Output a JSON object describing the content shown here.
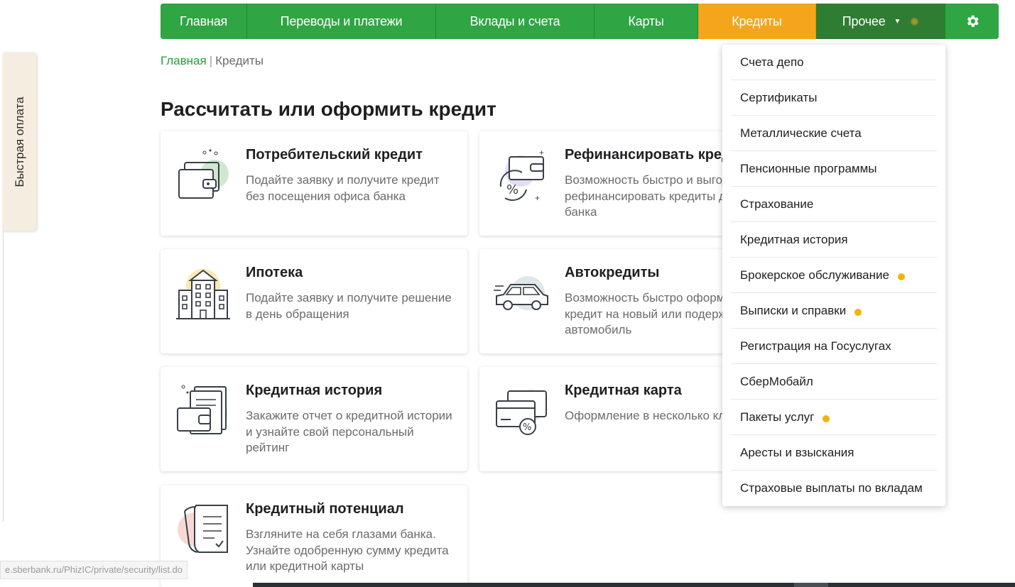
{
  "quick_pay": {
    "label": "Быстрая оплата"
  },
  "nav": {
    "items": [
      {
        "label": "Главная"
      },
      {
        "label": "Переводы и платежи"
      },
      {
        "label": "Вклады и счета"
      },
      {
        "label": "Карты"
      },
      {
        "label": "Кредиты"
      },
      {
        "label": "Прочее"
      }
    ],
    "active": "Кредиты"
  },
  "breadcrumb": {
    "home": "Главная",
    "current": "Кредиты"
  },
  "page_title": "Рассчитать или оформить кредит",
  "cards": [
    {
      "title": "Потребительский кредит",
      "desc": "Подайте заявку и получите кредит без посещения офиса банка"
    },
    {
      "title": "Рефинансировать кредиты",
      "desc": "Возможность быстро и выгодно рефинансировать кредиты другого банка"
    },
    {
      "title": "Ипотека",
      "desc": "Подайте заявку и получите решение в день обращения"
    },
    {
      "title": "Автокредиты",
      "desc": "Возможность быстро оформить кредит на новый или подержанный автомобиль"
    },
    {
      "title": "Кредитная история",
      "desc": "Закажите отчет о кредитной истории и узнайте свой персональный рейтинг"
    },
    {
      "title": "Кредитная карта",
      "desc": "Оформление в несколько кликов"
    },
    {
      "title": "Кредитный потенциал",
      "desc": "Взгляните на себя глазами банка. Узнайте одобренную сумму кредита или кредитной карты"
    }
  ],
  "dropdown": {
    "items": [
      {
        "label": "Счета депо"
      },
      {
        "label": "Сертификаты"
      },
      {
        "label": "Металлические счета"
      },
      {
        "label": "Пенсионные программы"
      },
      {
        "label": "Страхование"
      },
      {
        "label": "Кредитная история"
      },
      {
        "label": "Брокерское обслуживание"
      },
      {
        "label": "Выписки и справки"
      },
      {
        "label": "Регистрация на Госуслугах"
      },
      {
        "label": "СберМобайл"
      },
      {
        "label": "Пакеты услуг"
      },
      {
        "label": "Аресты и взыскания"
      },
      {
        "label": "Страховые выплаты по вкладам"
      }
    ]
  },
  "status_url": "e.sberbank.ru/PhizIC/private/security/list.do",
  "colors": {
    "brand_green": "#21a038",
    "active_orange": "#f4a51c",
    "badge_yellow": "#f4b400"
  }
}
